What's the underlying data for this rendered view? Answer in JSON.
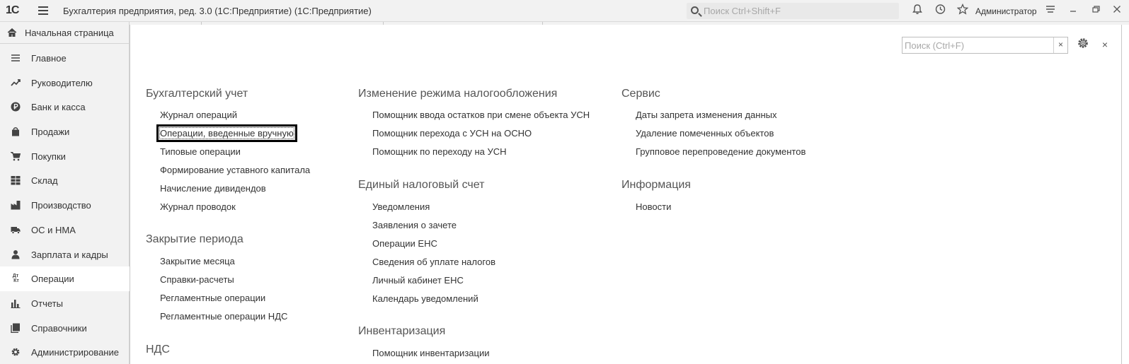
{
  "titlebar": {
    "logo": "1С",
    "title": "Бухгалтерия предприятия, ред. 3.0 (1С:Предприятие)  (1С:Предприятие)",
    "search_placeholder": "Поиск Ctrl+Shift+F",
    "user": "Администратор",
    "icons": [
      "bell-icon",
      "history-icon",
      "star-icon",
      "settings-lines-icon",
      "minimize-icon",
      "restore-icon",
      "close-icon"
    ]
  },
  "sidebar": {
    "home_label": "Начальная страница",
    "items": [
      {
        "label": "Главное",
        "icon": "menu-lines-icon"
      },
      {
        "label": "Руководителю",
        "icon": "trend-icon"
      },
      {
        "label": "Банк и касса",
        "icon": "ruble-coin-icon"
      },
      {
        "label": "Продажи",
        "icon": "shopping-bag-icon"
      },
      {
        "label": "Покупки",
        "icon": "cart-icon"
      },
      {
        "label": "Склад",
        "icon": "warehouse-grid-icon"
      },
      {
        "label": "Производство",
        "icon": "factory-icon"
      },
      {
        "label": "ОС и НМА",
        "icon": "truck-icon"
      },
      {
        "label": "Зарплата и кадры",
        "icon": "person-icon"
      },
      {
        "label": "Операции",
        "icon": "debit-credit-icon",
        "active": true
      },
      {
        "label": "Отчеты",
        "icon": "bar-chart-icon"
      },
      {
        "label": "Справочники",
        "icon": "books-icon"
      },
      {
        "label": "Администрирование",
        "icon": "gear-icon"
      }
    ]
  },
  "panel": {
    "search_placeholder": "Поиск (Ctrl+F)",
    "clear_label": "×",
    "close_label": "×"
  },
  "groups": {
    "accounting": {
      "title": "Бухгалтерский учет",
      "links": [
        "Журнал операций",
        "Операции, введенные вручную",
        "Типовые операции",
        "Формирование уставного капитала",
        "Начисление дивидендов",
        "Журнал проводок"
      ]
    },
    "closing": {
      "title": "Закрытие периода",
      "links": [
        "Закрытие месяца",
        "Справки-расчеты",
        "Регламентные операции",
        "Регламентные операции НДС"
      ]
    },
    "vat": {
      "title": "НДС"
    },
    "taxregime": {
      "title": "Изменение режима налогообложения",
      "links": [
        "Помощник ввода остатков при смене объекта УСН",
        "Помощник перехода с УСН на ОСНО",
        "Помощник по переходу на УСН"
      ]
    },
    "ens": {
      "title": "Единый налоговый счет",
      "links": [
        "Уведомления",
        "Заявления о зачете",
        "Операции ЕНС",
        "Сведения об уплате налогов",
        "Личный кабинет ЕНС",
        "Календарь уведомлений"
      ]
    },
    "inventory": {
      "title": "Инвентаризация",
      "links": [
        "Помощник инвентаризации"
      ]
    },
    "service": {
      "title": "Сервис",
      "links": [
        "Даты запрета изменения данных",
        "Удаление помеченных объектов",
        "Групповое перепроведение документов"
      ]
    },
    "info": {
      "title": "Информация",
      "links": [
        "Новости"
      ]
    }
  }
}
